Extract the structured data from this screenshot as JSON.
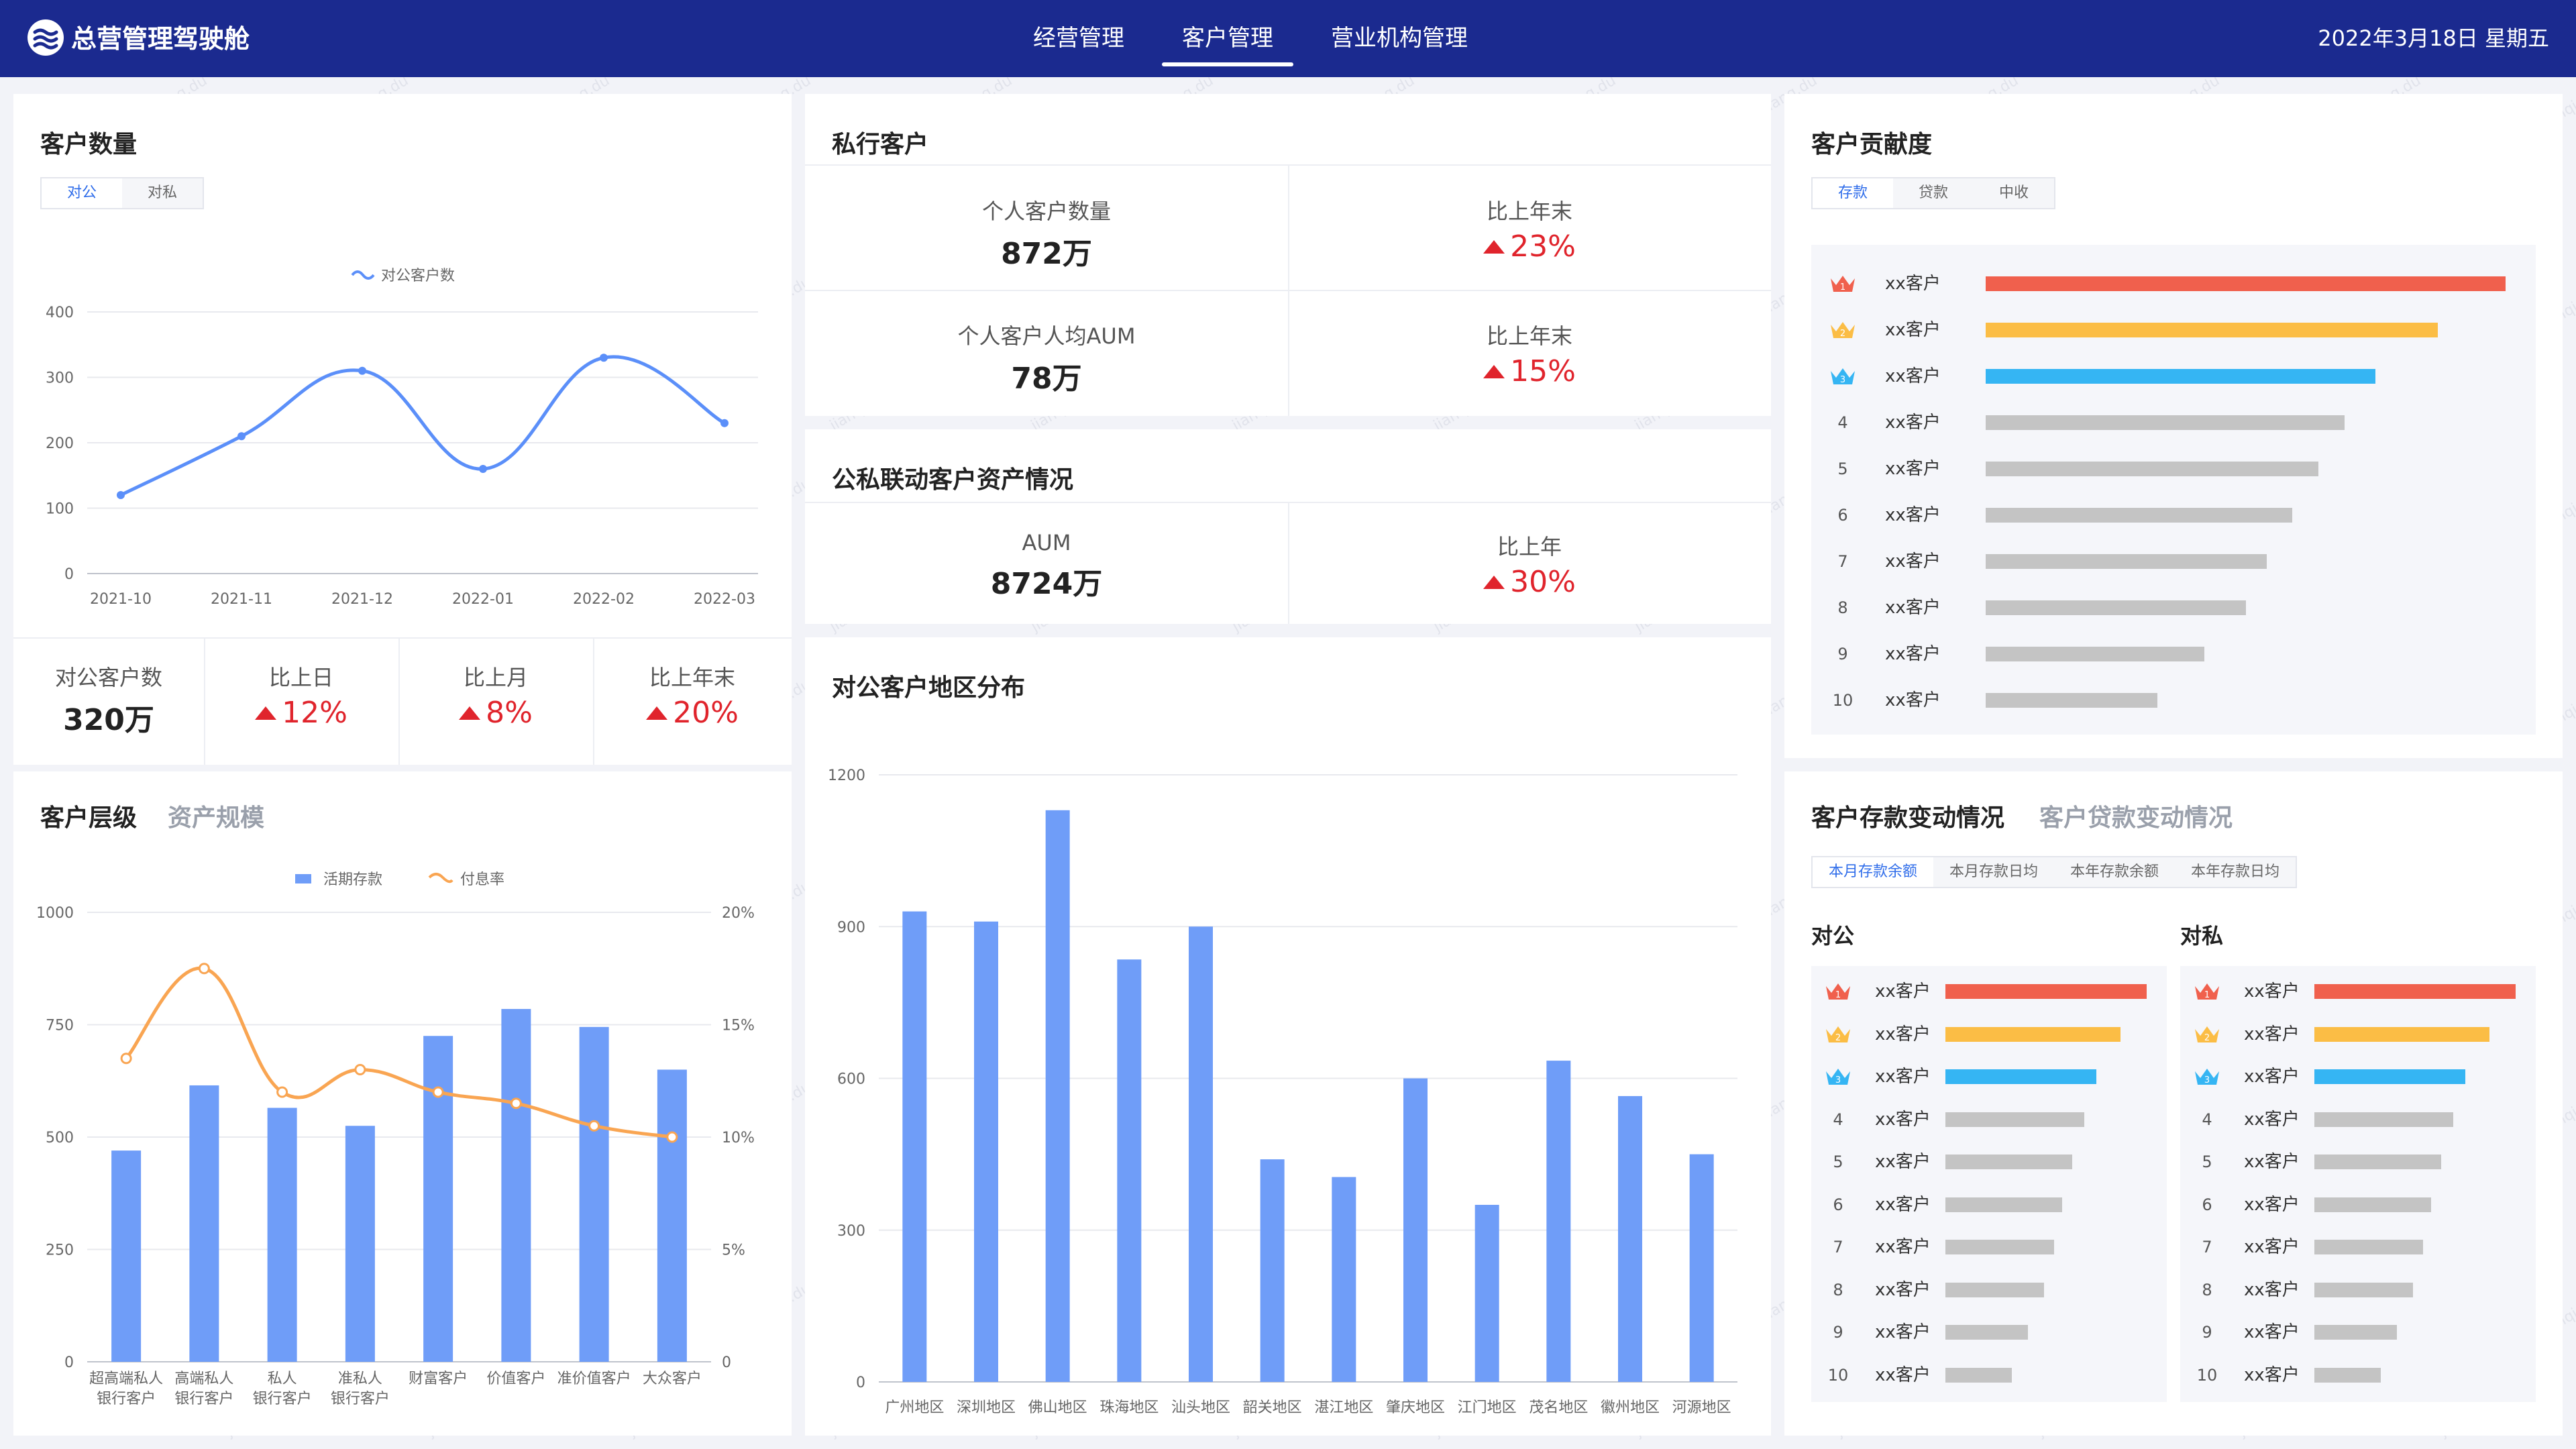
{
  "header": {
    "title": "总营管理驾驶舱",
    "nav": [
      "经营管理",
      "客户管理",
      "营业机构管理"
    ],
    "active_nav": 1,
    "datetime": "2022年3月18日 星期五"
  },
  "customer_count": {
    "title": "客户数量",
    "tabs": [
      "对公",
      "对私"
    ],
    "active_tab": 0,
    "kpis": [
      {
        "label": "对公客户数",
        "value": "320万"
      },
      {
        "label": "比上日",
        "value": "12%"
      },
      {
        "label": "比上月",
        "value": "8%"
      },
      {
        "label": "比上年末",
        "value": "20%"
      }
    ]
  },
  "private_customers": {
    "title": "私行客户",
    "kpis": [
      {
        "label": "个人客户数量",
        "value": "872万"
      },
      {
        "label": "比上年末",
        "value": "23%"
      },
      {
        "label": "个人客户人均AUM",
        "value": "78万"
      },
      {
        "label": "比上年末",
        "value": "15%"
      }
    ]
  },
  "linkage": {
    "title": "公私联动客户资产情况",
    "kpis": [
      {
        "label": "AUM",
        "value": "8724万"
      },
      {
        "label": "比上年",
        "value": "30%"
      }
    ]
  },
  "contribution": {
    "title": "客户贡献度",
    "tabs": [
      "存款",
      "贷款",
      "中收"
    ],
    "active_tab": 0,
    "rows": [
      {
        "rank": "1",
        "name": "xx客户",
        "value": 100
      },
      {
        "rank": "2",
        "name": "xx客户",
        "value": 87
      },
      {
        "rank": "3",
        "name": "xx客户",
        "value": 75
      },
      {
        "rank": "4",
        "name": "xx客户",
        "value": 69
      },
      {
        "rank": "5",
        "name": "xx客户",
        "value": 64
      },
      {
        "rank": "6",
        "name": "xx客户",
        "value": 59
      },
      {
        "rank": "7",
        "name": "xx客户",
        "value": 54
      },
      {
        "rank": "8",
        "name": "xx客户",
        "value": 50
      },
      {
        "rank": "9",
        "name": "xx客户",
        "value": 42
      },
      {
        "rank": "10",
        "name": "xx客户",
        "value": 33
      }
    ],
    "colors": [
      "#f0604d",
      "#fbbd45",
      "#35b5f3",
      "#c4c4c4"
    ]
  },
  "hierarchy": {
    "title_active": "客户层级",
    "title_inactive": "资产规模"
  },
  "region": {
    "title": "对公客户地区分布"
  },
  "deposit_change": {
    "title_active": "客户存款变动情况",
    "title_inactive": "客户贷款变动情况",
    "tabs": [
      "本月存款余额",
      "本月存款日均",
      "本年存款余额",
      "本年存款日均"
    ],
    "active_tab": 0,
    "col_left": "对公",
    "col_right": "对私",
    "left_rows": [
      {
        "rank": "1",
        "name": "xx客户",
        "value": 100
      },
      {
        "rank": "2",
        "name": "xx客户",
        "value": 87
      },
      {
        "rank": "3",
        "name": "xx客户",
        "value": 75
      },
      {
        "rank": "4",
        "name": "xx客户",
        "value": 69
      },
      {
        "rank": "5",
        "name": "xx客户",
        "value": 63
      },
      {
        "rank": "6",
        "name": "xx客户",
        "value": 58
      },
      {
        "rank": "7",
        "name": "xx客户",
        "value": 54
      },
      {
        "rank": "8",
        "name": "xx客户",
        "value": 49
      },
      {
        "rank": "9",
        "name": "xx客户",
        "value": 41
      },
      {
        "rank": "10",
        "name": "xx客户",
        "value": 33
      }
    ],
    "right_rows": [
      {
        "rank": "1",
        "name": "xx客户",
        "value": 100
      },
      {
        "rank": "2",
        "name": "xx客户",
        "value": 87
      },
      {
        "rank": "3",
        "name": "xx客户",
        "value": 75
      },
      {
        "rank": "4",
        "name": "xx客户",
        "value": 69
      },
      {
        "rank": "5",
        "name": "xx客户",
        "value": 63
      },
      {
        "rank": "6",
        "name": "xx客户",
        "value": 58
      },
      {
        "rank": "7",
        "name": "xx客户",
        "value": 54
      },
      {
        "rank": "8",
        "name": "xx客户",
        "value": 49
      },
      {
        "rank": "9",
        "name": "xx客户",
        "value": 41
      },
      {
        "rank": "10",
        "name": "xx客户",
        "value": 33
      }
    ]
  },
  "watermark": "jianqiang.du",
  "chart_data": [
    {
      "id": "customer-count-line",
      "type": "line",
      "series": [
        {
          "name": "对公客户数",
          "values": [
            120,
            210,
            310,
            160,
            330,
            230
          ],
          "color": "#5b8ff9"
        }
      ],
      "x": [
        "2021-10",
        "2021-11",
        "2021-12",
        "2022-01",
        "2022-02",
        "2022-03"
      ],
      "ylim": [
        0,
        400
      ],
      "yticks": [
        0,
        100,
        200,
        300,
        400
      ],
      "grid": true,
      "legend": "top-center"
    },
    {
      "id": "hierarchy-combo",
      "type": "bar",
      "categories": [
        "超高端私人银行客户",
        "高端私人银行客户",
        "私人银行客户",
        "准私人银行客户",
        "财富客户",
        "价值客户",
        "准价值客户",
        "大众客户"
      ],
      "category_lines": [
        [
          "超高端私人",
          "银行客户"
        ],
        [
          "高端私人",
          "银行客户"
        ],
        [
          "私人",
          "银行客户"
        ],
        [
          "准私人",
          "银行客户"
        ],
        [
          "财富客户"
        ],
        [
          "价值客户"
        ],
        [
          "准价值客户"
        ],
        [
          "大众客户"
        ]
      ],
      "series": [
        {
          "name": "活期存款",
          "type": "bar",
          "axis": "left",
          "values": [
            470,
            615,
            565,
            525,
            725,
            785,
            745,
            650
          ],
          "color": "#6f9df8"
        },
        {
          "name": "付息率",
          "type": "line",
          "axis": "right",
          "values": [
            13.5,
            17.5,
            12,
            13,
            12,
            11.5,
            10.5,
            10
          ],
          "color": "#f9a552"
        }
      ],
      "ylim_left": [
        0,
        1000
      ],
      "yticks_left": [
        0,
        250,
        500,
        750,
        1000
      ],
      "ylim_right": [
        0,
        20
      ],
      "yticks_right": [
        "0",
        "5%",
        "10%",
        "15%",
        "20%"
      ],
      "grid": true,
      "legend": "top-center"
    },
    {
      "id": "region-bars",
      "type": "bar",
      "categories": [
        "广州地区",
        "深圳地区",
        "佛山地区",
        "珠海地区",
        "汕头地区",
        "韶关地区",
        "湛江地区",
        "肇庆地区",
        "江门地区",
        "茂名地区",
        "徽州地区",
        "河源地区"
      ],
      "values": [
        930,
        910,
        1130,
        835,
        900,
        440,
        405,
        600,
        350,
        635,
        565,
        450
      ],
      "color": "#6f9df8",
      "ylim": [
        0,
        1200
      ],
      "yticks": [
        0,
        300,
        600,
        900,
        1200
      ],
      "grid": true
    }
  ]
}
